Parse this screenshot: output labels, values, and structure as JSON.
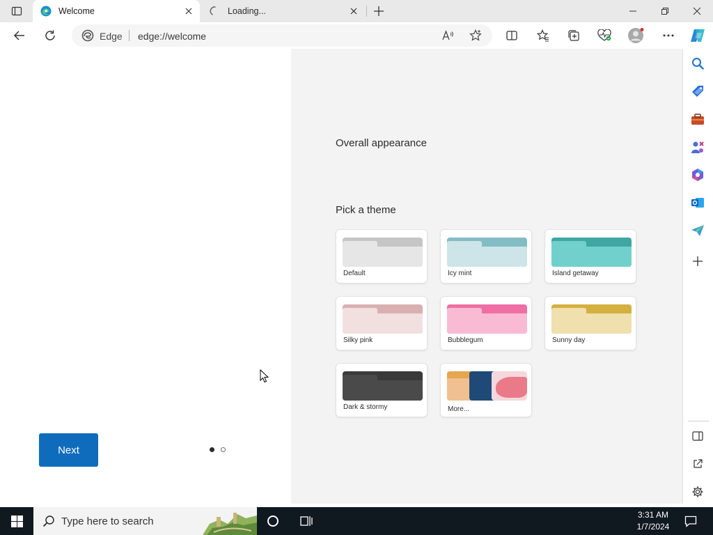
{
  "tabs": [
    {
      "title": "Welcome",
      "state": "active"
    },
    {
      "title": "Loading...",
      "state": "loading"
    }
  ],
  "toolbar": {
    "site_label": "Edge",
    "url": "edge://welcome"
  },
  "page": {
    "overall_heading": "Overall appearance",
    "theme_heading": "Pick a theme",
    "next_label": "Next",
    "page_count": 2,
    "current_page": 1,
    "themes": [
      {
        "name": "Default",
        "colors": [
          "#c6c6c6",
          "#e6e6e6"
        ]
      },
      {
        "name": "Icy mint",
        "colors": [
          "#84bcc4",
          "#cde5e8"
        ]
      },
      {
        "name": "Island getaway",
        "colors": [
          "#3fa6a4",
          "#72d0cc"
        ]
      },
      {
        "name": "Silky pink",
        "colors": [
          "#d9b0b2",
          "#f2e0e0"
        ]
      },
      {
        "name": "Bubblegum",
        "colors": [
          "#ef6fa4",
          "#f8bbd3"
        ]
      },
      {
        "name": "Sunny day",
        "colors": [
          "#d4b040",
          "#efe0ad"
        ]
      },
      {
        "name": "Dark & stormy",
        "colors": [
          "#3a3a3a",
          "#4a4a4a"
        ]
      },
      {
        "name": "More...",
        "colors": [
          "#e6a64f",
          "#1f4a78",
          "#e86a78"
        ]
      }
    ]
  },
  "sidebar": {
    "icons": [
      "search-icon",
      "shopping-tag-icon",
      "tools-icon",
      "games-icon",
      "microsoft-365-icon",
      "outlook-icon",
      "send-icon",
      "add-icon",
      "sidebar-layout-icon",
      "open-external-icon",
      "settings-icon"
    ]
  },
  "taskbar": {
    "search_placeholder": "Type here to search",
    "time": "3:31 AM",
    "date": "1/7/2024"
  }
}
